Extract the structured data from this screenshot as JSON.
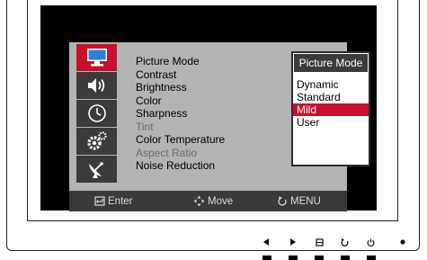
{
  "osd": {
    "sidebar": [
      {
        "icon": "monitor-icon",
        "active": true
      },
      {
        "icon": "speaker-icon",
        "active": false
      },
      {
        "icon": "clock-icon",
        "active": false
      },
      {
        "icon": "gears-icon",
        "active": false
      },
      {
        "icon": "satellite-icon",
        "active": false
      }
    ],
    "menu_items": [
      {
        "label": "Picture Mode",
        "enabled": true
      },
      {
        "label": "Contrast",
        "enabled": true
      },
      {
        "label": "Brightness",
        "enabled": true
      },
      {
        "label": "Color",
        "enabled": true
      },
      {
        "label": "Sharpness",
        "enabled": true
      },
      {
        "label": "Tint",
        "enabled": false
      },
      {
        "label": "Color Temperature",
        "enabled": true
      },
      {
        "label": "Aspect Ratio",
        "enabled": false
      },
      {
        "label": "Noise Reduction",
        "enabled": true
      }
    ],
    "submenu": {
      "title": "Picture Mode",
      "options": [
        "Dynamic",
        "Standard",
        "Mild",
        "User"
      ],
      "selected": "Mild"
    },
    "footer": {
      "enter_label": "Enter",
      "move_label": "Move",
      "menu_label": "MENU"
    }
  },
  "hardware_buttons": [
    {
      "icon": "left-arrow-icon"
    },
    {
      "icon": "right-arrow-icon"
    },
    {
      "icon": "input-source-icon"
    },
    {
      "icon": "auto-adjust-icon"
    },
    {
      "icon": "power-icon"
    },
    {
      "icon": "power-led-icon"
    }
  ],
  "colors": {
    "accent": "#c8102e",
    "osd_background": "#b3b3b3",
    "sidebar_item": "#3b3b3b",
    "footer": "#3a3a3a"
  }
}
